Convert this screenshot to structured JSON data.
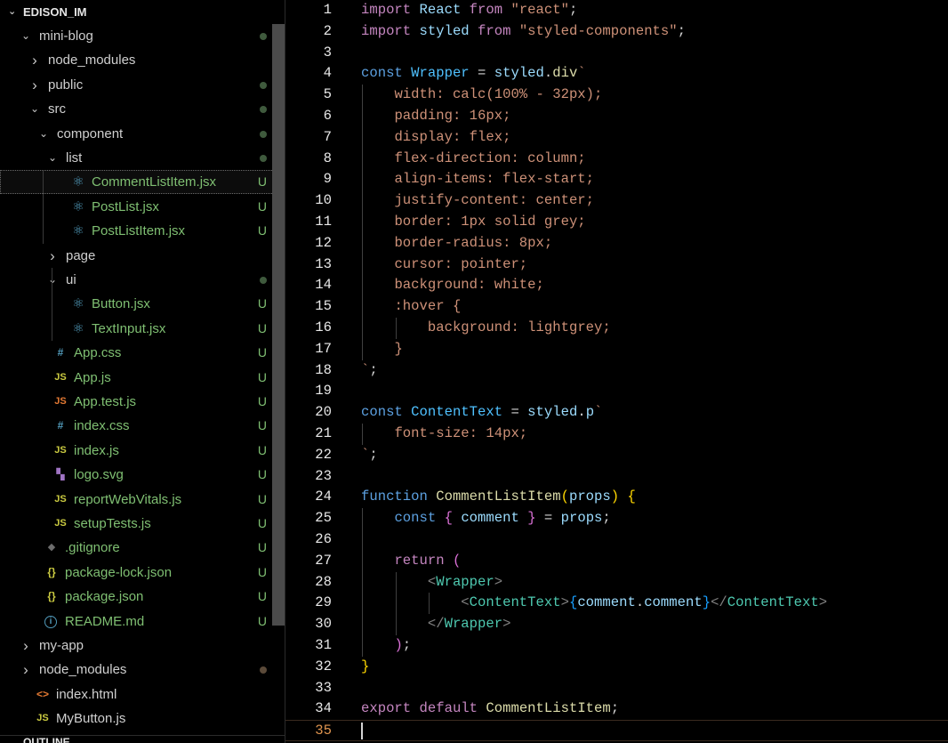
{
  "explorer": {
    "root_label": "EDISON_IM",
    "outline_label": "OUTLINE",
    "items": [
      {
        "label": "mini-blog",
        "kind": "folder",
        "open": true,
        "status": "dot"
      },
      {
        "label": "node_modules",
        "kind": "folder",
        "open": false,
        "status": ""
      },
      {
        "label": "public",
        "kind": "folder",
        "open": false,
        "status": "dot"
      },
      {
        "label": "src",
        "kind": "folder",
        "open": true,
        "status": "dot"
      },
      {
        "label": "component",
        "kind": "folder",
        "open": true,
        "status": "dot"
      },
      {
        "label": "list",
        "kind": "folder",
        "open": true,
        "status": "dot"
      },
      {
        "label": "CommentListItem.jsx",
        "kind": "react-icon",
        "status": "U",
        "selected": true
      },
      {
        "label": "PostList.jsx",
        "kind": "react-icon",
        "status": "U"
      },
      {
        "label": "PostListItem.jsx",
        "kind": "react-icon",
        "status": "U"
      },
      {
        "label": "page",
        "kind": "folder",
        "open": false,
        "status": ""
      },
      {
        "label": "ui",
        "kind": "folder",
        "open": true,
        "status": "dot"
      },
      {
        "label": "Button.jsx",
        "kind": "react-icon",
        "status": "U"
      },
      {
        "label": "TextInput.jsx",
        "kind": "react-icon",
        "status": "U"
      },
      {
        "label": "App.css",
        "kind": "css-icon",
        "icon_text": "#",
        "status": "U"
      },
      {
        "label": "App.js",
        "kind": "js-icon",
        "icon_text": "JS",
        "status": "U"
      },
      {
        "label": "App.test.js",
        "kind": "js-test-icon",
        "icon_text": "JS",
        "status": "U"
      },
      {
        "label": "index.css",
        "kind": "css-icon",
        "icon_text": "#",
        "status": "U"
      },
      {
        "label": "index.js",
        "kind": "js-icon",
        "icon_text": "JS",
        "status": "U"
      },
      {
        "label": "logo.svg",
        "kind": "svg-icon",
        "status": "U"
      },
      {
        "label": "reportWebVitals.js",
        "kind": "js-icon",
        "icon_text": "JS",
        "status": "U"
      },
      {
        "label": "setupTests.js",
        "kind": "js-icon",
        "icon_text": "JS",
        "status": "U"
      },
      {
        "label": ".gitignore",
        "kind": "git-icon",
        "status": "U"
      },
      {
        "label": "package-lock.json",
        "kind": "json-icon",
        "icon_text": "{}",
        "status": "U"
      },
      {
        "label": "package.json",
        "kind": "json-icon",
        "icon_text": "{}",
        "status": "U"
      },
      {
        "label": "README.md",
        "kind": "info-icon",
        "icon_text": "i",
        "status": "U"
      },
      {
        "label": "my-app",
        "kind": "folder",
        "open": false,
        "status": ""
      },
      {
        "label": "node_modules",
        "kind": "folder",
        "open": false,
        "status": "dot-muted"
      },
      {
        "label": "index.html",
        "kind": "html-icon",
        "icon_text": "<>",
        "status": ""
      },
      {
        "label": "MyButton.js",
        "kind": "js-icon",
        "icon_text": "JS",
        "status": ""
      }
    ]
  },
  "colors": {
    "background": "#000000",
    "untracked_green": "#7fbf72",
    "react_blue": "#519aba",
    "js_yellow": "#cbcb41",
    "js_test_orange": "#e37933",
    "json_yellow": "#cbcb41",
    "current_line_number": "#e0954f"
  },
  "editor": {
    "current_line": 35,
    "lines": [
      {
        "n": "1",
        "tokens": [
          [
            "kw",
            "import"
          ],
          [
            "pl",
            " "
          ],
          [
            "var",
            "React"
          ],
          [
            "pl",
            " "
          ],
          [
            "kw",
            "from"
          ],
          [
            "pl",
            " "
          ],
          [
            "str",
            "\"react\""
          ],
          [
            "pl",
            ";"
          ]
        ]
      },
      {
        "n": "2",
        "tokens": [
          [
            "kw",
            "import"
          ],
          [
            "pl",
            " "
          ],
          [
            "var",
            "styled"
          ],
          [
            "pl",
            " "
          ],
          [
            "kw",
            "from"
          ],
          [
            "pl",
            " "
          ],
          [
            "str",
            "\"styled-components\""
          ],
          [
            "pl",
            ";"
          ]
        ]
      },
      {
        "n": "3",
        "tokens": []
      },
      {
        "n": "4",
        "tokens": [
          [
            "dk",
            "const"
          ],
          [
            "pl",
            " "
          ],
          [
            "cv",
            "Wrapper"
          ],
          [
            "pl",
            " = "
          ],
          [
            "var",
            "styled"
          ],
          [
            "pl",
            "."
          ],
          [
            "fn",
            "div"
          ],
          [
            "str",
            "`"
          ]
        ]
      },
      {
        "n": "5",
        "tokens": [
          [
            "pl",
            "    "
          ],
          [
            "css",
            "width: calc(100% - 32px);"
          ]
        ]
      },
      {
        "n": "6",
        "tokens": [
          [
            "pl",
            "    "
          ],
          [
            "css",
            "padding: 16px;"
          ]
        ]
      },
      {
        "n": "7",
        "tokens": [
          [
            "pl",
            "    "
          ],
          [
            "css",
            "display: flex;"
          ]
        ]
      },
      {
        "n": "8",
        "tokens": [
          [
            "pl",
            "    "
          ],
          [
            "css",
            "flex-direction: column;"
          ]
        ]
      },
      {
        "n": "9",
        "tokens": [
          [
            "pl",
            "    "
          ],
          [
            "css",
            "align-items: flex-start;"
          ]
        ]
      },
      {
        "n": "10",
        "tokens": [
          [
            "pl",
            "    "
          ],
          [
            "css",
            "justify-content: center;"
          ]
        ]
      },
      {
        "n": "11",
        "tokens": [
          [
            "pl",
            "    "
          ],
          [
            "css",
            "border: 1px solid grey;"
          ]
        ]
      },
      {
        "n": "12",
        "tokens": [
          [
            "pl",
            "    "
          ],
          [
            "css",
            "border-radius: 8px;"
          ]
        ]
      },
      {
        "n": "13",
        "tokens": [
          [
            "pl",
            "    "
          ],
          [
            "css",
            "cursor: pointer;"
          ]
        ]
      },
      {
        "n": "14",
        "tokens": [
          [
            "pl",
            "    "
          ],
          [
            "css",
            "background: white;"
          ]
        ]
      },
      {
        "n": "15",
        "tokens": [
          [
            "pl",
            "    "
          ],
          [
            "css",
            ":hover {"
          ]
        ]
      },
      {
        "n": "16",
        "tokens": [
          [
            "pl",
            "        "
          ],
          [
            "css",
            "background: lightgrey;"
          ]
        ]
      },
      {
        "n": "17",
        "tokens": [
          [
            "pl",
            "    "
          ],
          [
            "css",
            "}"
          ]
        ]
      },
      {
        "n": "18",
        "tokens": [
          [
            "str",
            "`"
          ],
          [
            "pl",
            ";"
          ]
        ]
      },
      {
        "n": "19",
        "tokens": []
      },
      {
        "n": "20",
        "tokens": [
          [
            "dk",
            "const"
          ],
          [
            "pl",
            " "
          ],
          [
            "cv",
            "ContentText"
          ],
          [
            "pl",
            " = "
          ],
          [
            "var",
            "styled"
          ],
          [
            "pl",
            "."
          ],
          [
            "var",
            "p"
          ],
          [
            "str",
            "`"
          ]
        ]
      },
      {
        "n": "21",
        "tokens": [
          [
            "pl",
            "    "
          ],
          [
            "css",
            "font-size: 14px;"
          ]
        ]
      },
      {
        "n": "22",
        "tokens": [
          [
            "str",
            "`"
          ],
          [
            "pl",
            ";"
          ]
        ]
      },
      {
        "n": "23",
        "tokens": []
      },
      {
        "n": "24",
        "tokens": [
          [
            "dk",
            "function"
          ],
          [
            "pl",
            " "
          ],
          [
            "fn",
            "CommentListItem"
          ],
          [
            "br1",
            "("
          ],
          [
            "var",
            "props"
          ],
          [
            "br1",
            ")"
          ],
          [
            "pl",
            " "
          ],
          [
            "br1",
            "{"
          ]
        ]
      },
      {
        "n": "25",
        "tokens": [
          [
            "pl",
            "    "
          ],
          [
            "dk",
            "const"
          ],
          [
            "pl",
            " "
          ],
          [
            "br2",
            "{"
          ],
          [
            "pl",
            " "
          ],
          [
            "var",
            "comment"
          ],
          [
            "pl",
            " "
          ],
          [
            "br2",
            "}"
          ],
          [
            "pl",
            " = "
          ],
          [
            "var",
            "props"
          ],
          [
            "pl",
            ";"
          ]
        ]
      },
      {
        "n": "26",
        "tokens": []
      },
      {
        "n": "27",
        "tokens": [
          [
            "pl",
            "    "
          ],
          [
            "kw",
            "return"
          ],
          [
            "pl",
            " "
          ],
          [
            "br2",
            "("
          ]
        ]
      },
      {
        "n": "28",
        "tokens": [
          [
            "pl",
            "        "
          ],
          [
            "gray",
            "<"
          ],
          [
            "tag",
            "Wrapper"
          ],
          [
            "gray",
            ">"
          ]
        ]
      },
      {
        "n": "29",
        "tokens": [
          [
            "pl",
            "            "
          ],
          [
            "gray",
            "<"
          ],
          [
            "tag",
            "ContentText"
          ],
          [
            "gray",
            ">"
          ],
          [
            "br3",
            "{"
          ],
          [
            "var",
            "comment"
          ],
          [
            "pl",
            "."
          ],
          [
            "var",
            "comment"
          ],
          [
            "br3",
            "}"
          ],
          [
            "gray",
            "</"
          ],
          [
            "tag",
            "ContentText"
          ],
          [
            "gray",
            ">"
          ]
        ]
      },
      {
        "n": "30",
        "tokens": [
          [
            "pl",
            "        "
          ],
          [
            "gray",
            "</"
          ],
          [
            "tag",
            "Wrapper"
          ],
          [
            "gray",
            ">"
          ]
        ]
      },
      {
        "n": "31",
        "tokens": [
          [
            "pl",
            "    "
          ],
          [
            "br2",
            ")"
          ],
          [
            "pl",
            ";"
          ]
        ]
      },
      {
        "n": "32",
        "tokens": [
          [
            "br1",
            "}"
          ]
        ]
      },
      {
        "n": "33",
        "tokens": []
      },
      {
        "n": "34",
        "tokens": [
          [
            "kw",
            "export"
          ],
          [
            "pl",
            " "
          ],
          [
            "kw",
            "default"
          ],
          [
            "pl",
            " "
          ],
          [
            "fn",
            "CommentListItem"
          ],
          [
            "pl",
            ";"
          ]
        ]
      },
      {
        "n": "35",
        "tokens": []
      }
    ]
  }
}
